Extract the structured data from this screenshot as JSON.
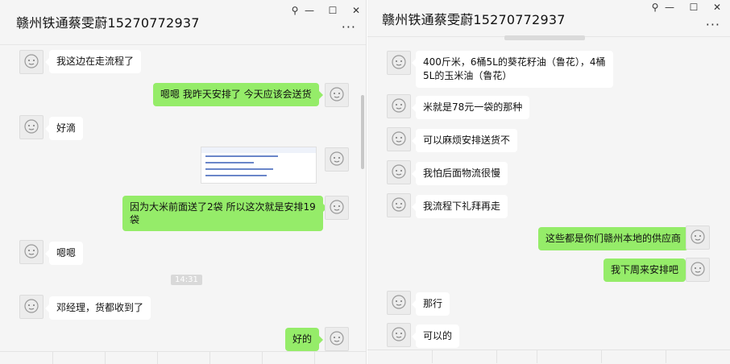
{
  "left_window": {
    "title": "赣州铁通蔡雯蔚15270772937",
    "controls": {
      "pin": "⚲",
      "minimize": "—",
      "maximize": "☐",
      "close": "✕",
      "more": "···"
    },
    "messages": [
      {
        "from": "contact",
        "text": "我这边在走流程了"
      },
      {
        "from": "me",
        "text": "嗯嗯  我昨天安排了  今天应该会送货"
      },
      {
        "from": "contact",
        "text": "好滴"
      },
      {
        "from": "me",
        "type": "image"
      },
      {
        "from": "me",
        "text": "因为大米前面送了2袋  所以这次就是安排19",
        "text_line2": "袋"
      },
      {
        "from": "contact",
        "text": "嗯嗯"
      },
      {
        "type": "time",
        "text": "14:31"
      },
      {
        "from": "contact",
        "text": "邓经理，货都收到了"
      },
      {
        "from": "me",
        "text": "好的"
      }
    ]
  },
  "right_window": {
    "title": "赣州铁通蔡雯蔚15270772937",
    "controls": {
      "pin": "⚲",
      "minimize": "—",
      "maximize": "☐",
      "close": "✕",
      "more": "···"
    },
    "messages": [
      {
        "from": "contact",
        "text": "400斤米，6桶5L的葵花籽油（鲁花），4桶",
        "text_line2": "5L的玉米油（鲁花）"
      },
      {
        "from": "contact",
        "text": "米就是78元一袋的那种"
      },
      {
        "from": "contact",
        "text": "可以麻烦安排送货不"
      },
      {
        "from": "contact",
        "text": "我怕后面物流很慢"
      },
      {
        "from": "contact",
        "text": "我流程下礼拜再走"
      },
      {
        "from": "me",
        "text": "这些都是你们赣州本地的供应商"
      },
      {
        "from": "me",
        "text": "我下周来安排吧"
      },
      {
        "from": "contact",
        "text": "那行"
      },
      {
        "from": "contact",
        "text": "可以的"
      }
    ]
  },
  "colors": {
    "outgoing_bubble": "#95ec69",
    "incoming_bubble": "#ffffff",
    "chat_background": "#f5f5f5"
  },
  "icons": {
    "contact_avatar": "avatar-icon",
    "my_avatar": "avatar-icon"
  }
}
